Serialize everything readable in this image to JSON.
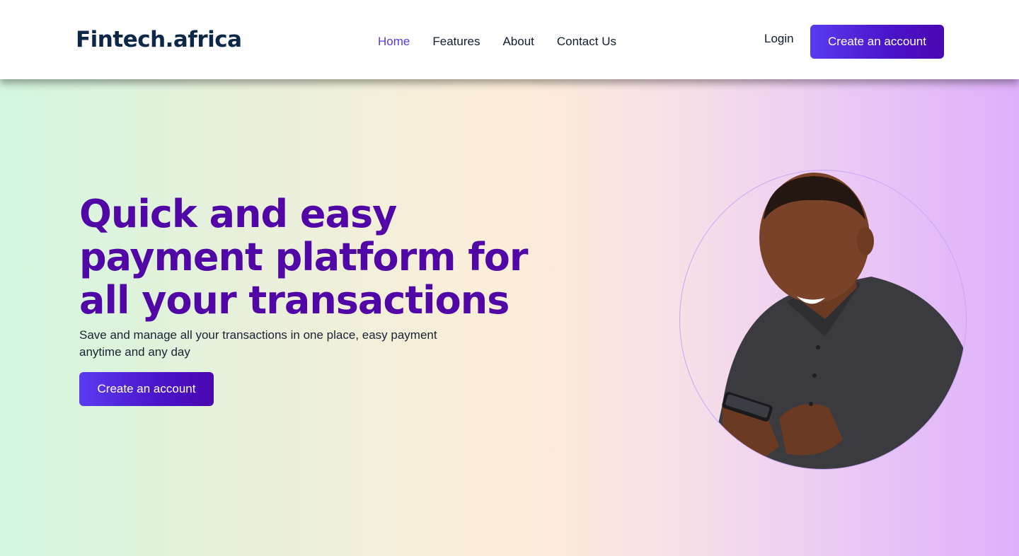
{
  "header": {
    "logo": "Fintech.africa",
    "nav": [
      {
        "label": "Home",
        "active": true
      },
      {
        "label": "Features",
        "active": false
      },
      {
        "label": "About",
        "active": false
      },
      {
        "label": "Contact Us",
        "active": false
      }
    ],
    "login_label": "Login",
    "cta_label": "Create an account"
  },
  "hero": {
    "headline": "Quick and easy payment platform for all your transactions",
    "subtext": "Save and manage all your transactions in one place, easy payment anytime and any day",
    "cta_label": "Create an account",
    "image_icon": "person-with-phone-photo"
  },
  "colors": {
    "accent": "#5a3ae8",
    "headline": "#5107a6",
    "logo": "#0c2748",
    "button_gradient_start": "#5a3bf0",
    "button_gradient_end": "#4a07b0"
  }
}
